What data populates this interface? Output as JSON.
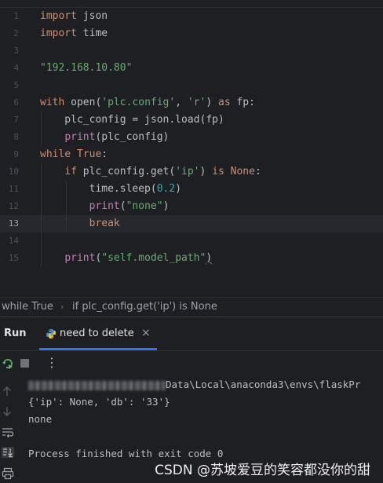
{
  "editor": {
    "lines": [
      {
        "n": "1",
        "tokens": [
          {
            "t": "import",
            "c": "kw"
          },
          {
            "t": " json",
            "c": ""
          }
        ]
      },
      {
        "n": "2",
        "tokens": [
          {
            "t": "import",
            "c": "kw"
          },
          {
            "t": " time",
            "c": ""
          }
        ]
      },
      {
        "n": "3",
        "tokens": []
      },
      {
        "n": "4",
        "tokens": [
          {
            "t": "\"192.168.10.80\"",
            "c": "str"
          }
        ]
      },
      {
        "n": "5",
        "tokens": []
      },
      {
        "n": "6",
        "tokens": [
          {
            "t": "with",
            "c": "kw"
          },
          {
            "t": " open(",
            "c": ""
          },
          {
            "t": "'plc.config'",
            "c": "str"
          },
          {
            "t": ", ",
            "c": ""
          },
          {
            "t": "'r'",
            "c": "str"
          },
          {
            "t": ") ",
            "c": ""
          },
          {
            "t": "as",
            "c": "kw"
          },
          {
            "t": " fp:",
            "c": ""
          }
        ]
      },
      {
        "n": "7",
        "tokens": [
          {
            "t": "    plc_config = json.load(fp)",
            "c": ""
          }
        ]
      },
      {
        "n": "8",
        "tokens": [
          {
            "t": "    ",
            "c": ""
          },
          {
            "t": "print",
            "c": "fn"
          },
          {
            "t": "(plc_config)",
            "c": ""
          }
        ]
      },
      {
        "n": "9",
        "tokens": [
          {
            "t": "while",
            "c": "kw"
          },
          {
            "t": " ",
            "c": ""
          },
          {
            "t": "True",
            "c": "kw"
          },
          {
            "t": ":",
            "c": ""
          }
        ]
      },
      {
        "n": "10",
        "tokens": [
          {
            "t": "    ",
            "c": ""
          },
          {
            "t": "if",
            "c": "kw"
          },
          {
            "t": " plc_config.get(",
            "c": ""
          },
          {
            "t": "'ip'",
            "c": "str"
          },
          {
            "t": ") ",
            "c": ""
          },
          {
            "t": "is",
            "c": "kw"
          },
          {
            "t": " ",
            "c": ""
          },
          {
            "t": "None",
            "c": "kw"
          },
          {
            "t": ":",
            "c": ""
          }
        ]
      },
      {
        "n": "11",
        "tokens": [
          {
            "t": "        time.sleep(",
            "c": ""
          },
          {
            "t": "0.2",
            "c": "num"
          },
          {
            "t": ")",
            "c": ""
          }
        ]
      },
      {
        "n": "12",
        "tokens": [
          {
            "t": "        ",
            "c": ""
          },
          {
            "t": "print",
            "c": "fn"
          },
          {
            "t": "(",
            "c": ""
          },
          {
            "t": "\"none\"",
            "c": "str"
          },
          {
            "t": ")",
            "c": ""
          }
        ]
      },
      {
        "n": "13",
        "tokens": [
          {
            "t": "        ",
            "c": ""
          },
          {
            "t": "break",
            "c": "kw"
          }
        ],
        "current": true
      },
      {
        "n": "14",
        "tokens": []
      },
      {
        "n": "15",
        "tokens": [
          {
            "t": "    ",
            "c": ""
          },
          {
            "t": "print",
            "c": "fn"
          },
          {
            "t": "(",
            "c": ""
          },
          {
            "t": "\"self.model_path\"",
            "c": "str"
          },
          {
            "t": ")",
            "c": "squig"
          }
        ]
      }
    ]
  },
  "breadcrumb": {
    "items": [
      "while True",
      "if plc_config.get('ip') is None"
    ],
    "separator": "›"
  },
  "run_panel": {
    "title": "Run",
    "tab_label": "need to delete",
    "tab_close": "×",
    "more_menu": "⋮",
    "icons": [
      "rerun-icon",
      "stop-icon",
      "more-icon",
      "up-arrow-icon",
      "down-arrow-icon",
      "soft-wrap-icon",
      "scroll-to-end-icon",
      "print-icon"
    ]
  },
  "console": {
    "path_suffix": "Data\\Local\\anaconda3\\envs\\flaskPr",
    "lines": [
      "{'ip': None, 'db': '33'}",
      "none",
      "",
      "Process finished with exit code 0"
    ]
  },
  "watermark": "CSDN @苏坡爱豆的笑容都没你的甜",
  "colors": {
    "background": "#1e1f22",
    "keyword": "#cf8e6d",
    "string": "#6aab73",
    "builtin": "#c77dbb",
    "number": "#2aacb8",
    "accent": "#3574f0"
  }
}
